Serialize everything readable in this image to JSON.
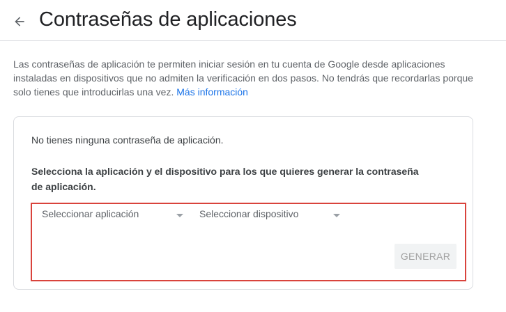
{
  "header": {
    "back_icon": "arrow-back-icon",
    "title": "Contraseñas de aplicaciones"
  },
  "intro": {
    "text": "Las contraseñas de aplicación te permiten iniciar sesión en tu cuenta de Google desde aplicaciones instaladas en dispositivos que no admiten la verificación en dos pasos. No tendrás que recordarlas porque solo tienes que introducirlas una vez.",
    "link_label": "Más información"
  },
  "card": {
    "empty_message": "No tienes ninguna contraseña de aplicación.",
    "instruction": "Selecciona la aplicación y el dispositivo para los que quieres generar la contraseña de aplicación.",
    "app_select": {
      "label": "Seleccionar aplicación",
      "icon": "dropdown-arrow-icon"
    },
    "device_select": {
      "label": "Seleccionar dispositivo",
      "icon": "dropdown-arrow-icon"
    },
    "generate_button": "GENERAR"
  },
  "colors": {
    "accent_link": "#1a73e8",
    "highlight_border": "#d9433c",
    "disabled_button_bg": "#f1f3f4"
  }
}
